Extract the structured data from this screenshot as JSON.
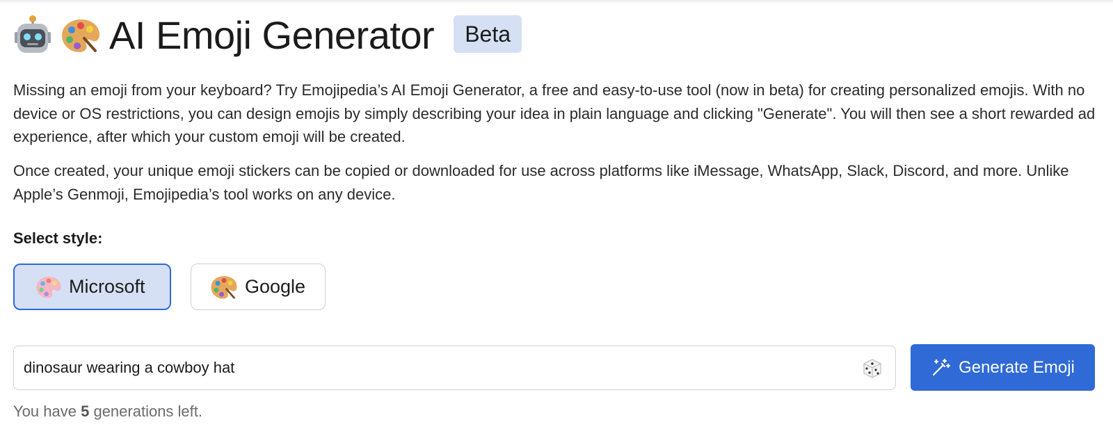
{
  "header": {
    "emoji_icons": [
      "robot-icon",
      "artist-palette-icon"
    ],
    "title": "AI Emoji Generator",
    "badge": "Beta"
  },
  "intro": {
    "paragraph1": "Missing an emoji from your keyboard? Try Emojipedia’s AI Emoji Generator, a free and easy-to-use tool (now in beta) for creating personalized emojis. With no device or OS restrictions, you can design emojis by simply describing your idea in plain language and clicking \"Generate\". You will then see a short rewarded ad experience, after which your custom emoji will be created.",
    "paragraph2": "Once created, your unique emoji stickers can be copied or downloaded for use across platforms like iMessage, WhatsApp, Slack, Discord, and more. Unlike Apple’s Genmoji, Emojipedia’s tool works on any device."
  },
  "style_selector": {
    "label": "Select style:",
    "options": [
      {
        "label": "Microsoft",
        "icon": "artist-palette-icon",
        "selected": true
      },
      {
        "label": "Google",
        "icon": "artist-palette-icon",
        "selected": false
      }
    ]
  },
  "prompt": {
    "value": "dinosaur wearing a cowboy hat",
    "random_icon": "dice-icon"
  },
  "generate_button": {
    "label": "Generate Emoji",
    "icon": "magic-wand-icon"
  },
  "generations": {
    "prefix": "You have",
    "count": "5",
    "suffix": "generations left."
  },
  "colors": {
    "accent": "#2f6ad6",
    "selected_bg": "#d5e0f5",
    "badge_bg": "#d5e0f5"
  }
}
